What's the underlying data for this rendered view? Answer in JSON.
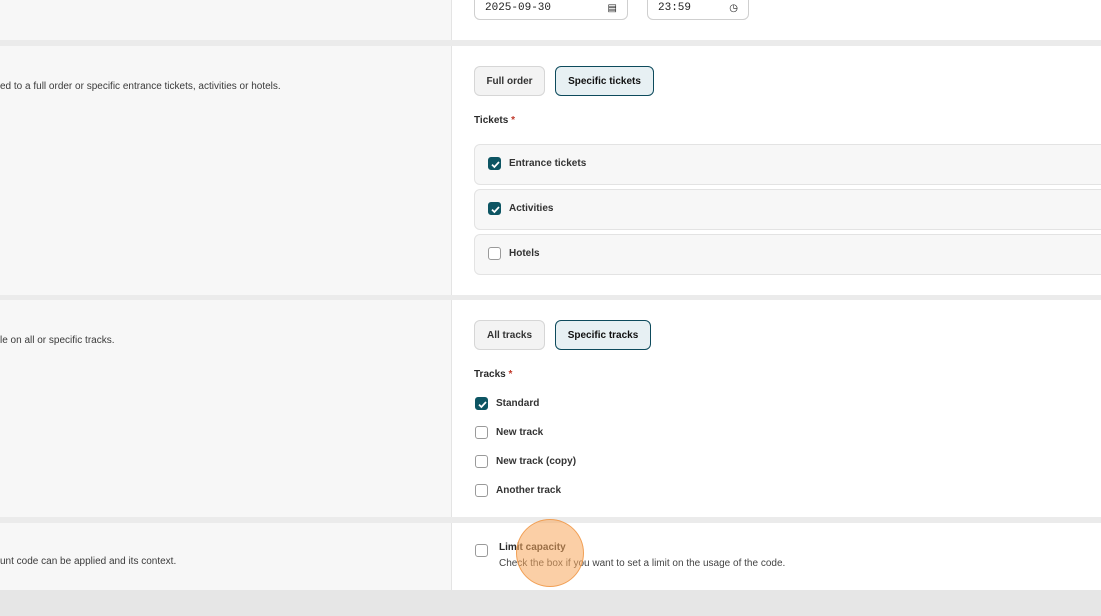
{
  "validity": {
    "date_value": "2025-09-30",
    "time_value": "23:59"
  },
  "applies_to": {
    "description": "ed to a full order or specific entrance tickets, activities or hotels.",
    "option_full": "Full order",
    "option_specific": "Specific tickets",
    "tickets_label": "Tickets",
    "required_mark": "*",
    "tickets": [
      {
        "label": "Entrance tickets",
        "checked": true
      },
      {
        "label": "Activities",
        "checked": true
      },
      {
        "label": "Hotels",
        "checked": false
      }
    ]
  },
  "tracks": {
    "description": "le on all or specific tracks.",
    "option_all": "All tracks",
    "option_specific": "Specific tracks",
    "tracks_label": "Tracks",
    "required_mark": "*",
    "items": [
      {
        "label": "Standard",
        "checked": true
      },
      {
        "label": "New track",
        "checked": false
      },
      {
        "label": "New track (copy)",
        "checked": false
      },
      {
        "label": "Another track",
        "checked": false
      }
    ]
  },
  "capacity": {
    "description": "unt code can be applied and its context.",
    "title": "Limit capacity",
    "help": "Check the box if you want to set a limit on the usage of the code.",
    "checked": false
  },
  "colors": {
    "accent": "#0d5563",
    "click_highlight": "#f7a85c"
  },
  "icons": {
    "date": "calendar-icon",
    "time": "clock-icon",
    "check": "check-icon"
  }
}
